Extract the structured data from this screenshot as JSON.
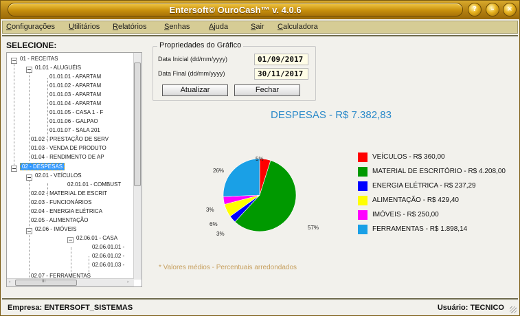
{
  "window": {
    "title": "Entersoft© OuroCash™ v. 4.0.6"
  },
  "title_buttons": [
    {
      "icon": "help-icon",
      "glyph": "?"
    },
    {
      "icon": "minimize-icon",
      "glyph": "–"
    },
    {
      "icon": "close-icon",
      "glyph": "×"
    }
  ],
  "menu": [
    "Configurações",
    "Utilitários",
    "Relatórios",
    "Senhas",
    "Ajuda",
    "Sair",
    "Calculadora"
  ],
  "tree": {
    "label": "SELECIONE:",
    "items": [
      "01 - RECEITAS",
      "01.01 - ALUGUÉIS",
      "01.01.01 - APARTAM",
      "01.01.02 - APARTAM",
      "01.01.03 - APARTAM",
      "01.01.04 - APARTAM",
      "01.01.05 - CASA 1 - F",
      "01.01.06 - GALPAO",
      "01.01.07 - SALA 201",
      "01.02 - PRESTAÇÃO DE SERV",
      "01.03 - VENDA DE PRODUTO",
      "01.04 - RENDIMENTO DE AP",
      "02 - DESPESAS",
      "02.01 - VEÍCULOS",
      "02.01.01 - COMBUST",
      "02.02 - MATERIAL DE ESCRIT",
      "02.03 - FUNCIONÁRIOS",
      "02.04 - ENERGIA ELÉTRICA",
      "02.05 - ALIMENTAÇÃO",
      "02.06 - IMÓVEIS",
      "02.06.01 - CASA",
      "02.06.01.01 -",
      "02.06.01.02 -",
      "02.06.01.03 -",
      "02.07 - FERRAMENTAS"
    ],
    "selected": "02 - DESPESAS",
    "scroll_left": "‹",
    "scroll_mark": "III",
    "scroll_right": "›"
  },
  "properties": {
    "title": "Propriedades do Gráfico",
    "start_label": "Data Inicial (dd/mm/yyyy)",
    "start_value": "01/09/2017",
    "end_label": "Data Final (dd/mm/yyyy)",
    "end_value": "30/11/2017",
    "update_button": "Atualizar",
    "close_button": "Fechar"
  },
  "chart_data": {
    "type": "pie",
    "title": "DESPESAS - R$ 7.382,83",
    "slices": [
      {
        "label": "VEÍCULOS - R$ 360,00",
        "value": 360.0,
        "percent": "5%",
        "color": "#ff0000"
      },
      {
        "label": "MATERIAL DE ESCRITÓRIO - R$ 4.208,00",
        "value": 4208.0,
        "percent": "57%",
        "color": "#009900"
      },
      {
        "label": "ENERGIA ELÉTRICA - R$ 237,29",
        "value": 237.29,
        "percent": "3%",
        "color": "#0000ff"
      },
      {
        "label": "ALIMENTAÇÃO - R$ 429,40",
        "value": 429.4,
        "percent": "6%",
        "color": "#ffff00"
      },
      {
        "label": "IMÓVEIS - R$ 250,00",
        "value": 250.0,
        "percent": "3%",
        "color": "#ff00ff"
      },
      {
        "label": "FERRAMENTAS - R$ 1.898,14",
        "value": 1898.14,
        "percent": "26%",
        "color": "#1aa0e6"
      }
    ],
    "legend_position": "right",
    "footnote": "* Valores médios - Percentuais arredondados"
  },
  "status": {
    "company": "Empresa: ENTERSOFT_SISTEMAS",
    "user": "Usuário: TECNICO"
  },
  "colors": {
    "title_gold": "#c8900c",
    "menu_bg": "#d6cc95",
    "chart_title": "#2a89c9",
    "selection": "#3399ff"
  }
}
